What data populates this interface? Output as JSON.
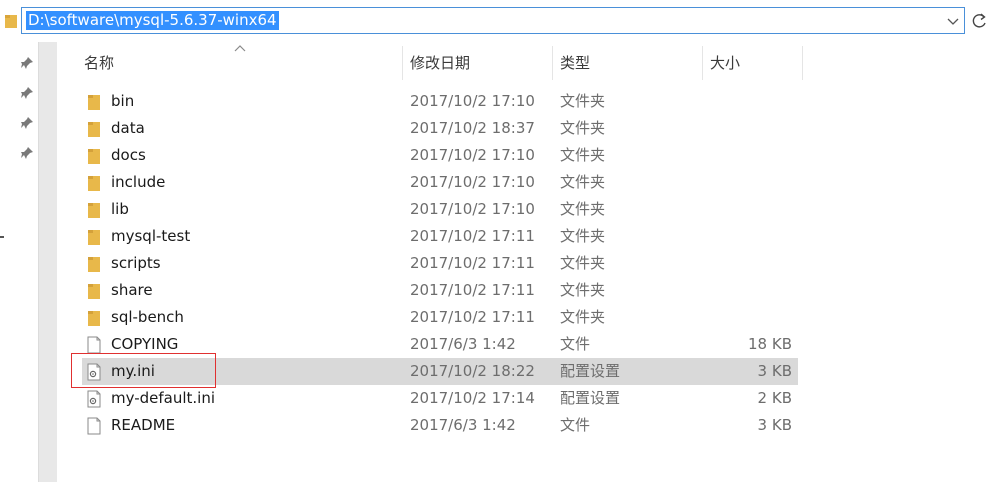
{
  "address_bar": {
    "path": "D:\\software\\mysql-5.6.37-winx64"
  },
  "columns": {
    "name": "名称",
    "date": "修改日期",
    "type": "类型",
    "size": "大小"
  },
  "files": [
    {
      "name": "bin",
      "date": "2017/10/2 17:10",
      "type": "文件夹",
      "size": "",
      "icon": "folder-icon"
    },
    {
      "name": "data",
      "date": "2017/10/2 18:37",
      "type": "文件夹",
      "size": "",
      "icon": "folder-icon"
    },
    {
      "name": "docs",
      "date": "2017/10/2 17:10",
      "type": "文件夹",
      "size": "",
      "icon": "folder-icon"
    },
    {
      "name": "include",
      "date": "2017/10/2 17:10",
      "type": "文件夹",
      "size": "",
      "icon": "folder-icon"
    },
    {
      "name": "lib",
      "date": "2017/10/2 17:10",
      "type": "文件夹",
      "size": "",
      "icon": "folder-icon"
    },
    {
      "name": "mysql-test",
      "date": "2017/10/2 17:11",
      "type": "文件夹",
      "size": "",
      "icon": "folder-icon"
    },
    {
      "name": "scripts",
      "date": "2017/10/2 17:11",
      "type": "文件夹",
      "size": "",
      "icon": "folder-icon"
    },
    {
      "name": "share",
      "date": "2017/10/2 17:11",
      "type": "文件夹",
      "size": "",
      "icon": "folder-icon"
    },
    {
      "name": "sql-bench",
      "date": "2017/10/2 17:11",
      "type": "文件夹",
      "size": "",
      "icon": "folder-icon"
    },
    {
      "name": "COPYING",
      "date": "2017/6/3 1:42",
      "type": "文件",
      "size": "18 KB",
      "icon": "file-icon"
    },
    {
      "name": "my.ini",
      "date": "2017/10/2 18:22",
      "type": "配置设置",
      "size": "3 KB",
      "icon": "config-file-icon",
      "selected": true
    },
    {
      "name": "my-default.ini",
      "date": "2017/10/2 17:14",
      "type": "配置设置",
      "size": "2 KB",
      "icon": "config-file-icon"
    },
    {
      "name": "README",
      "date": "2017/6/3 1:42",
      "type": "文件",
      "size": "3 KB",
      "icon": "file-icon"
    }
  ],
  "colors": {
    "selection_highlight": "#3390ff",
    "row_selected": "#d9d9d9",
    "folder": "#e8b84a",
    "annotation_box": "#e03030"
  }
}
